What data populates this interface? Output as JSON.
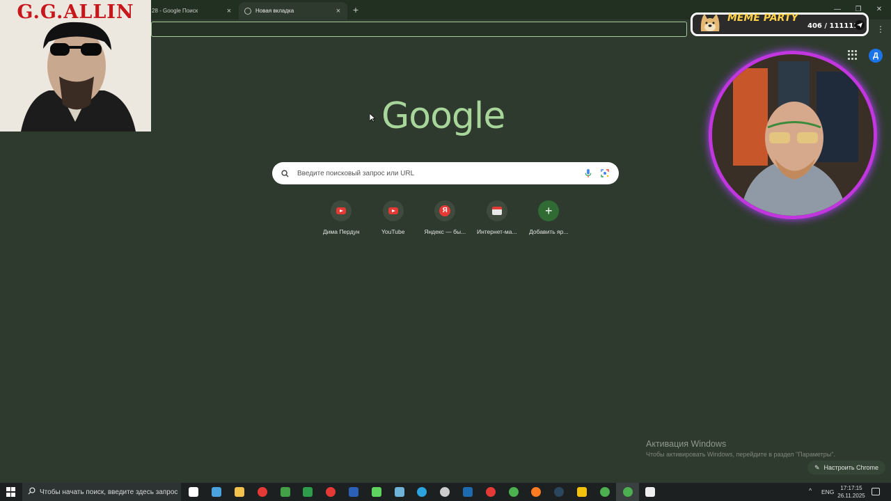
{
  "browser": {
    "tabs": [
      {
        "title": "28 - Google Поиск",
        "active": false
      },
      {
        "title": "Новая вкладка",
        "active": true
      }
    ],
    "tab_close_glyph": "×",
    "new_tab_glyph": "+",
    "window_controls": {
      "minimize": "—",
      "restore": "❐",
      "close": "✕"
    },
    "menu_glyph": "⋮"
  },
  "newtab": {
    "logo": "Google",
    "search_placeholder": "Введите поисковый запрос или URL",
    "shortcuts": [
      {
        "label": "Дима Пердун",
        "icon": "youtube-icon"
      },
      {
        "label": "YouTube",
        "icon": "youtube-icon"
      },
      {
        "label": "Яндекс — бы...",
        "icon": "yandex-icon",
        "glyph": "Я"
      },
      {
        "label": "Интернет-ма...",
        "icon": "shop-icon"
      },
      {
        "label": "Добавить яр...",
        "icon": "plus-icon",
        "glyph": "+"
      }
    ],
    "profile_initial": "Д",
    "customize_label": "Настроить Chrome",
    "customize_icon": "✎"
  },
  "activation": {
    "title": "Активация Windows",
    "subtitle": "Чтобы активировать Windows, перейдите в раздел \"Параметры\"."
  },
  "overlays": {
    "poster_title": "G.G.ALLIN",
    "meme_title": "MEME PARTY",
    "meme_count": "406 / 111111"
  },
  "taskbar": {
    "search_placeholder": "Чтобы начать поиск, введите здесь запрос",
    "pinned": [
      {
        "name": "task-view",
        "color": "#ffffff"
      },
      {
        "name": "explorer-app",
        "color": "#4aa3df"
      },
      {
        "name": "file-folder",
        "color": "#f2c14e"
      },
      {
        "name": "opera-gx",
        "color": "#e53935"
      },
      {
        "name": "app-green-red",
        "color": "#43a047"
      },
      {
        "name": "app-green",
        "color": "#2e9d4b"
      },
      {
        "name": "opera",
        "color": "#e53935"
      },
      {
        "name": "word",
        "color": "#2b5fb8"
      },
      {
        "name": "play-app",
        "color": "#5fd35f"
      },
      {
        "name": "paint-app",
        "color": "#6fb3d9"
      },
      {
        "name": "telegram",
        "color": "#2aa3df"
      },
      {
        "name": "app-circle",
        "color": "#cccccc"
      },
      {
        "name": "photoshop",
        "color": "#1d6bb0"
      },
      {
        "name": "yandex-browser",
        "color": "#e53935"
      },
      {
        "name": "chrome",
        "color": "#4caf50"
      },
      {
        "name": "firefox",
        "color": "#ff7b22"
      },
      {
        "name": "steam",
        "color": "#2a475e"
      },
      {
        "name": "app-yellow",
        "color": "#f4c20d"
      },
      {
        "name": "chrome-2",
        "color": "#4caf50"
      },
      {
        "name": "chrome-active",
        "color": "#4caf50"
      },
      {
        "name": "app-dark",
        "color": "#eeeeee"
      }
    ],
    "lang": "ENG",
    "time": "17:17:15",
    "date": "26.11.2025"
  }
}
